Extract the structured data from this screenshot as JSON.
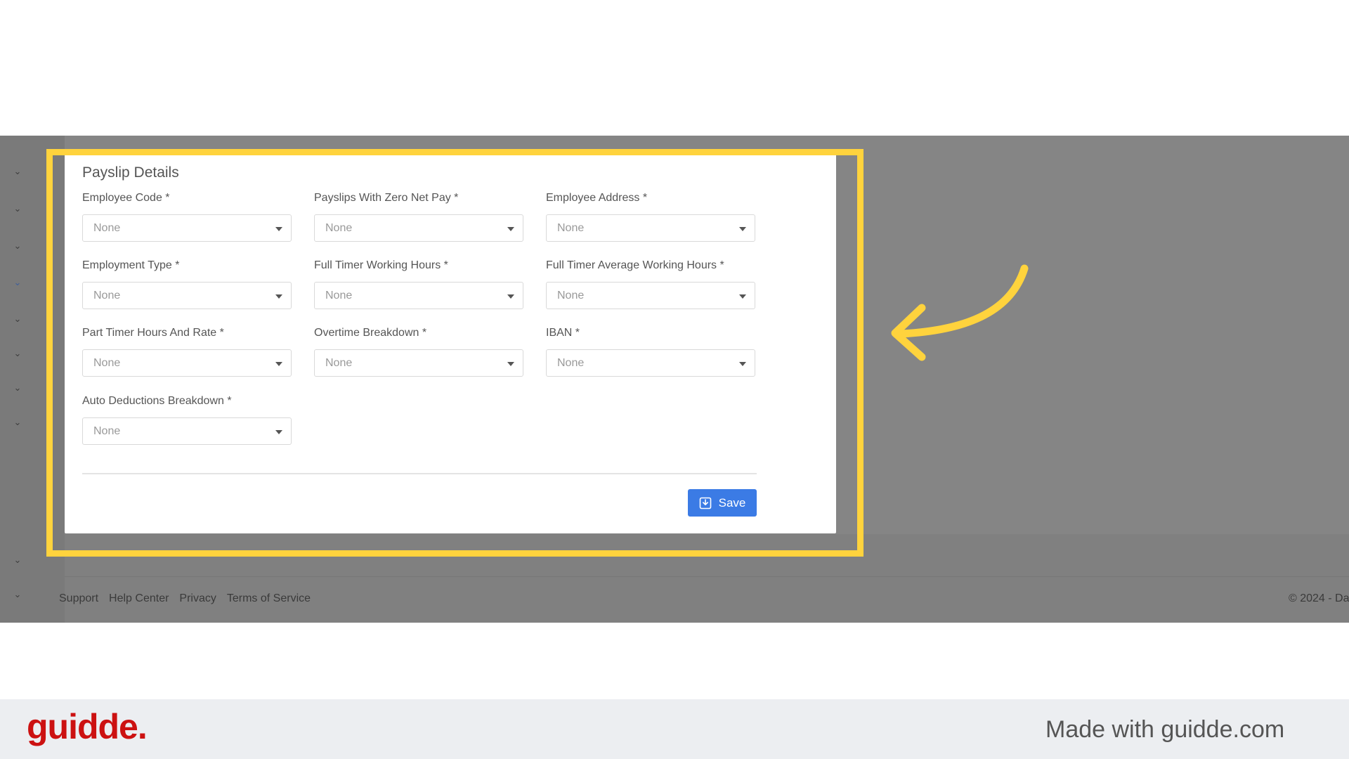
{
  "panel": {
    "title": "Payslip Details",
    "fields": [
      {
        "label": "Employee Code *",
        "value": "None"
      },
      {
        "label": "Payslips With Zero Net Pay *",
        "value": "None"
      },
      {
        "label": "Employee Address *",
        "value": "None"
      },
      {
        "label": "Employment Type *",
        "value": "None"
      },
      {
        "label": "Full Timer Working Hours *",
        "value": "None"
      },
      {
        "label": "Full Timer Average Working Hours  *",
        "value": "None"
      },
      {
        "label": "Part Timer Hours And Rate *",
        "value": "None"
      },
      {
        "label": "Overtime Breakdown *",
        "value": "None"
      },
      {
        "label": "IBAN *",
        "value": "None"
      },
      {
        "label": "Auto Deductions Breakdown *",
        "value": "None"
      }
    ],
    "save_label": "Save"
  },
  "footer": {
    "links": [
      "Support",
      "Help Center",
      "Privacy",
      "Terms of Service"
    ],
    "copyright": "© 2024 - Da"
  },
  "branding": {
    "logo": "guidde.",
    "made_with": "Made with guidde.com"
  },
  "colors": {
    "highlight": "#ffd33d",
    "save_button": "#3b7be5",
    "logo": "#cc1111"
  },
  "icons": [
    "chevron-down-icon",
    "save-icon",
    "caret-down-icon",
    "curved-arrow-icon"
  ]
}
